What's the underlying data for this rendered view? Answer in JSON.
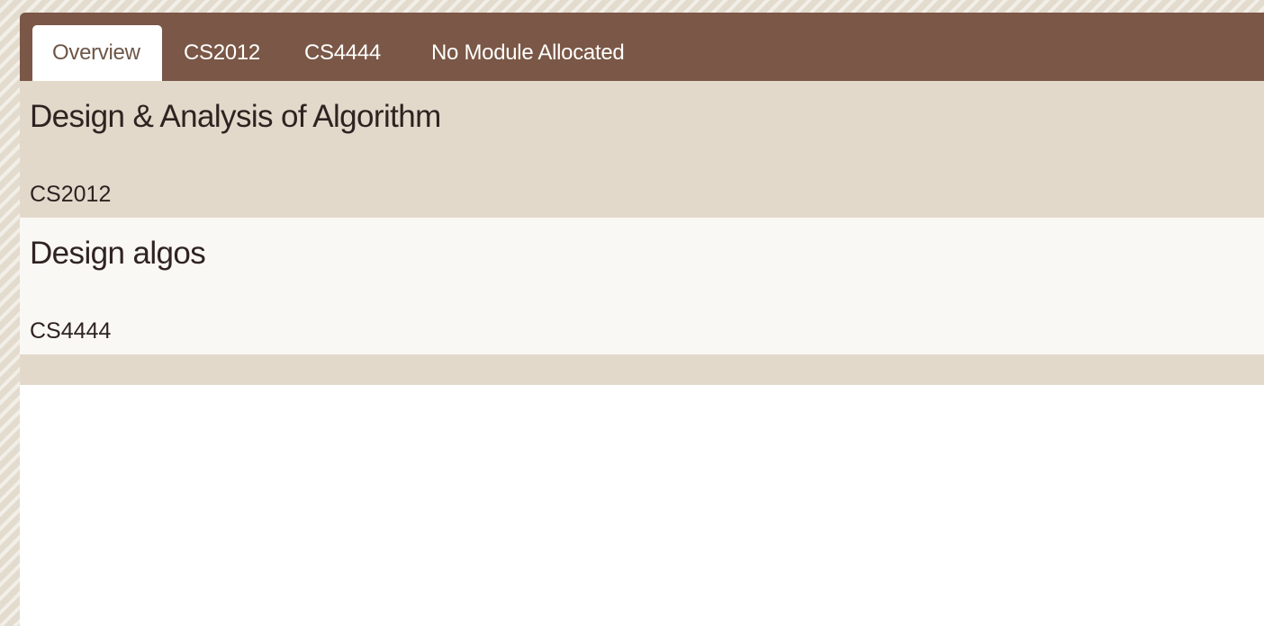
{
  "tabs": [
    {
      "label": "Overview",
      "active": true
    },
    {
      "label": "CS2012",
      "active": false
    },
    {
      "label": "CS4444",
      "active": false
    },
    {
      "label": "No Module Allocated",
      "active": false
    }
  ],
  "modules": [
    {
      "name": "Design & Analysis of Algorithm",
      "code": "CS2012"
    },
    {
      "name": "Design algos",
      "code": "CS4444"
    }
  ],
  "colors": {
    "tabbar": "#7a5746",
    "row_odd": "#e2d9cb",
    "row_even": "#faf8f5",
    "text": "#2f2321",
    "active_tab_text": "#6e5647"
  }
}
